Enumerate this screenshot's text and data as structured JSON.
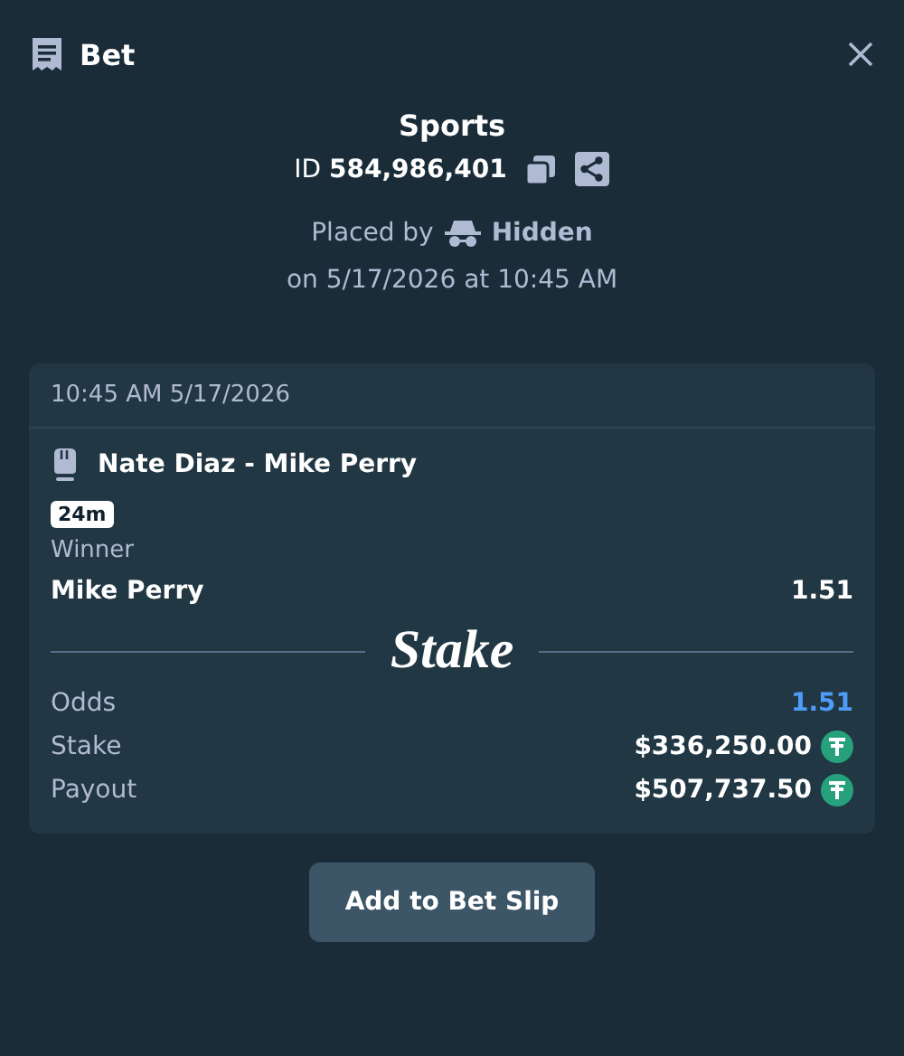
{
  "header": {
    "title": "Bet"
  },
  "summary": {
    "category": "Sports",
    "bet_id": "ID **584,986,401**",
    "placed_by_label": "Placed by",
    "placed_by_user": "Hidden",
    "placed_on": "on 5/17/2026 at 10:45 AM"
  },
  "card": {
    "timestamp": "10:45 AM 5/17/2026",
    "event": "Nate Diaz - Mike Perry",
    "live_time": "24m",
    "market": "Winner",
    "selection": "Mike Perry",
    "selection_odds": "1.51",
    "logo": "Stake",
    "rows": [
      {
        "label": "Odds",
        "value": "1.51",
        "kind": "odds"
      },
      {
        "label": "Stake",
        "value": "$336,250.00",
        "kind": "currency"
      },
      {
        "label": "Payout",
        "value": "$507,737.50",
        "kind": "currency"
      }
    ]
  },
  "button": "Add to Bet Slip"
}
